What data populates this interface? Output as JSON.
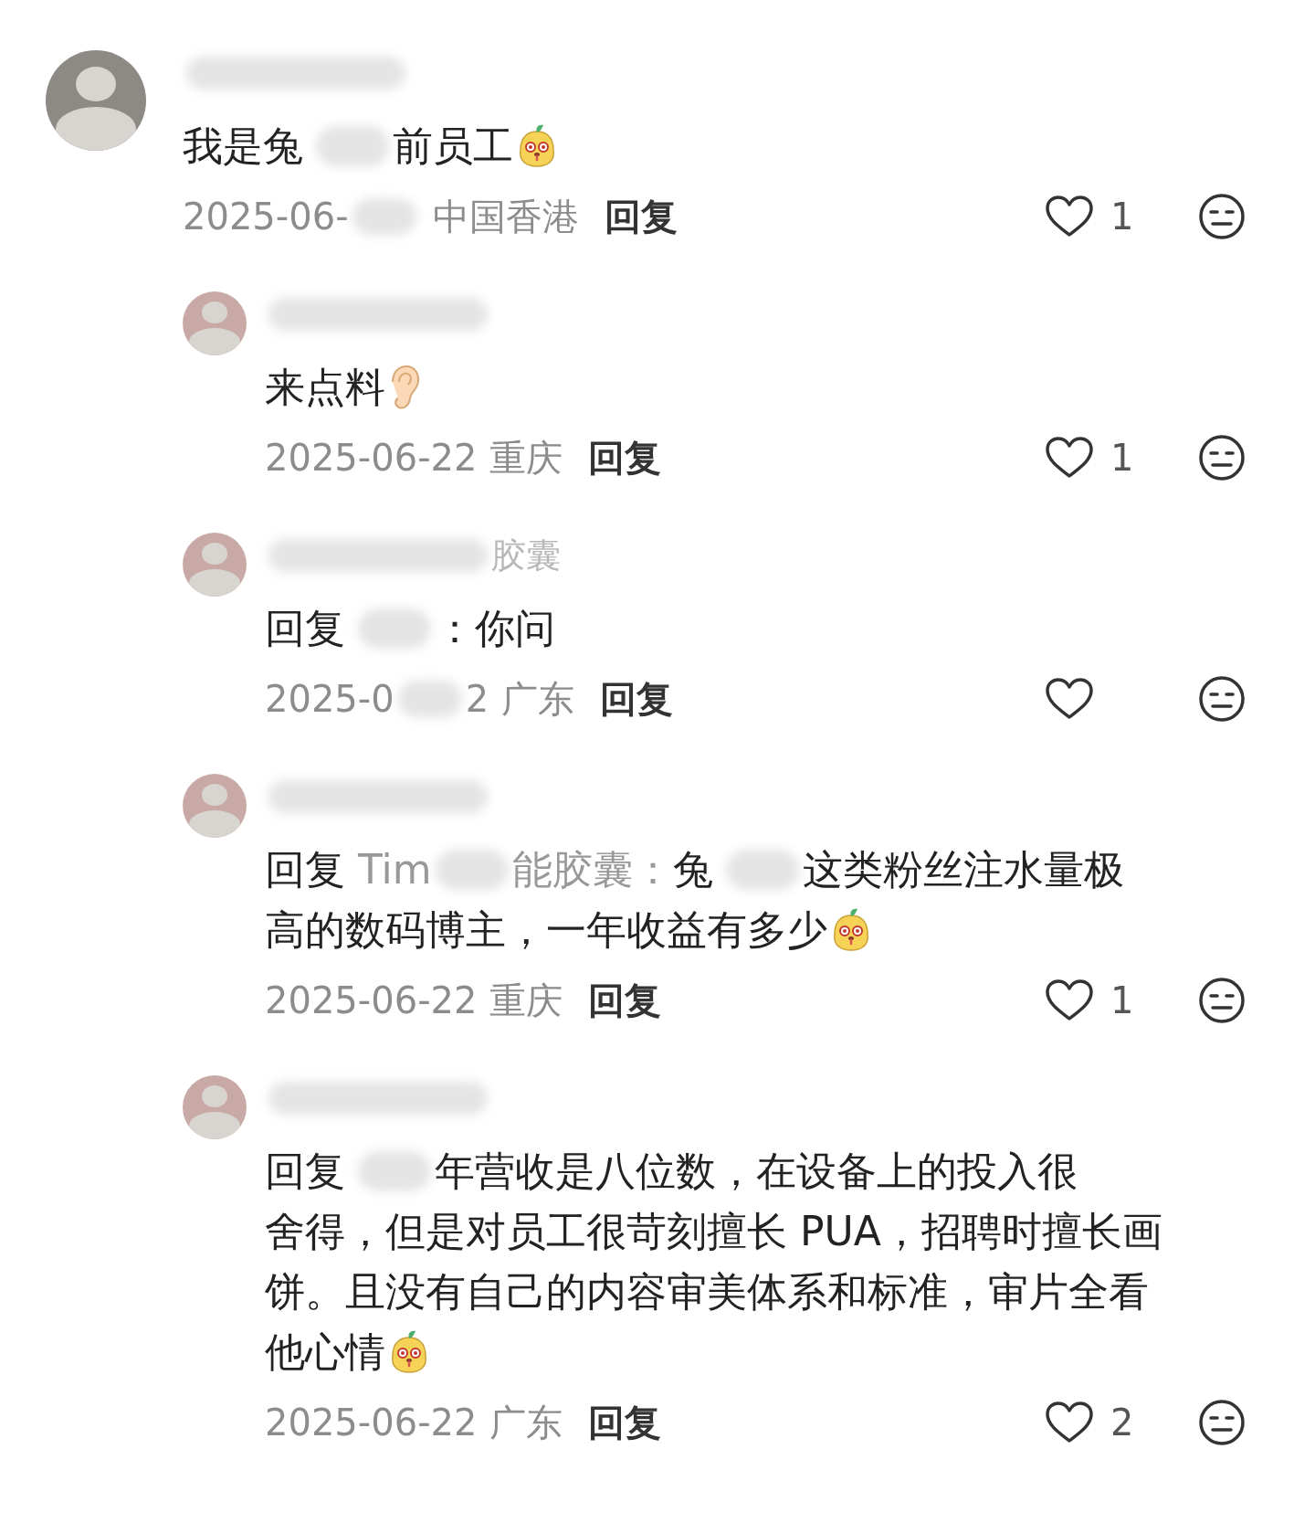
{
  "comments": [
    {
      "name": [
        {
          "kind": "blur"
        }
      ],
      "body": [
        [
          {
            "kind": "text",
            "text": "我是兔"
          },
          {
            "kind": "blur"
          },
          {
            "kind": "text",
            "text": "前员工"
          },
          {
            "kind": "mascot"
          }
        ]
      ],
      "date": [
        {
          "kind": "text",
          "text": "2025-06-"
        },
        {
          "kind": "blur"
        }
      ],
      "location": "中国香港",
      "reply": "回复",
      "liked": false,
      "likes": "1",
      "replies": [
        {
          "name": [
            {
              "kind": "blur"
            }
          ],
          "body": [
            [
              {
                "kind": "text",
                "text": "来点料"
              },
              {
                "kind": "ear"
              }
            ]
          ],
          "date": [
            {
              "kind": "text",
              "text": "2025-06-22"
            }
          ],
          "location": "重庆",
          "reply": "回复",
          "liked": false,
          "likes": "1"
        },
        {
          "name": [
            {
              "kind": "blur"
            },
            {
              "kind": "text",
              "text": "胶囊"
            }
          ],
          "body": [
            [
              {
                "kind": "text",
                "text": "回复"
              },
              {
                "kind": "blur"
              },
              {
                "kind": "text",
                "text": "：你问"
              }
            ]
          ],
          "date": [
            {
              "kind": "text",
              "text": "2025-0"
            },
            {
              "kind": "blur"
            },
            {
              "kind": "text",
              "text": "2"
            }
          ],
          "location": "广东",
          "reply": "回复",
          "liked": false
        },
        {
          "name": [
            {
              "kind": "blur"
            }
          ],
          "body": [
            [
              {
                "kind": "text",
                "text": "回复"
              },
              {
                "kind": "mention",
                "text": "Tim"
              },
              {
                "kind": "blur"
              },
              {
                "kind": "mention",
                "text": "能胶囊："
              },
              {
                "kind": "text",
                "text": "兔"
              },
              {
                "kind": "blur"
              },
              {
                "kind": "text",
                "text": "这类粉丝注水量极"
              }
            ],
            [
              {
                "kind": "text",
                "text": "高的数码博主，一年收益有多少"
              },
              {
                "kind": "mascot"
              }
            ]
          ],
          "date": [
            {
              "kind": "text",
              "text": "2025-06-22"
            }
          ],
          "location": "重庆",
          "reply": "回复",
          "liked": false,
          "likes": "1"
        },
        {
          "name": [
            {
              "kind": "blur"
            }
          ],
          "body": [
            [
              {
                "kind": "text",
                "text": "回复"
              },
              {
                "kind": "blur"
              },
              {
                "kind": "text",
                "text": "年营收是八位数，在设备上的投入很"
              }
            ],
            [
              {
                "kind": "text",
                "text": "舍得，但是对员工很苛刻擅长 PUA，招聘时擅长画"
              }
            ],
            [
              {
                "kind": "text",
                "text": "饼。且没有自己的内容审美体系和标准，审片全看"
              }
            ],
            [
              {
                "kind": "text",
                "text": "他心情"
              },
              {
                "kind": "mascot"
              }
            ]
          ],
          "date": [
            {
              "kind": "text",
              "text": "2025-06-22"
            }
          ],
          "location": "广东",
          "reply": "回复",
          "liked": false,
          "likes": "2"
        }
      ]
    }
  ]
}
